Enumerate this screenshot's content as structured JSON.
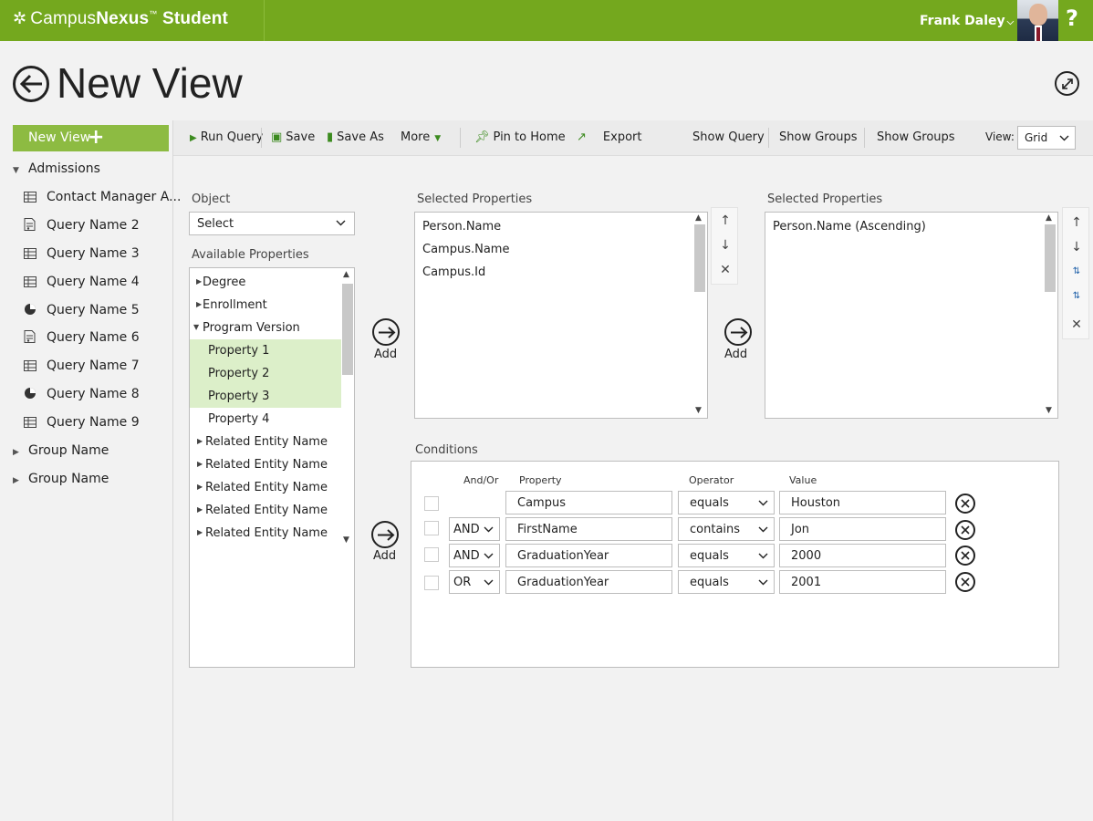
{
  "app": {
    "logo_prefix": "Campus",
    "logo_bold": "Nexus",
    "logo_tm": "™",
    "logo_suffix": " Student",
    "user_name": "Frank Daley",
    "help_label": "?"
  },
  "page": {
    "title": "New View"
  },
  "sidebar": {
    "new_view_label": "New View",
    "groups": [
      {
        "label": "Admissions",
        "expanded": true
      },
      {
        "label": "Group Name",
        "expanded": false
      },
      {
        "label": "Group Name",
        "expanded": false
      }
    ],
    "items": [
      {
        "label": "Contact Manager A...",
        "icon": "grid-icon"
      },
      {
        "label": "Query Name 2",
        "icon": "document-icon"
      },
      {
        "label": "Query Name 3",
        "icon": "grid-icon"
      },
      {
        "label": "Query Name 4",
        "icon": "grid-icon"
      },
      {
        "label": "Query Name 5",
        "icon": "pie-chart-icon"
      },
      {
        "label": "Query Name 6",
        "icon": "document-icon"
      },
      {
        "label": "Query Name 7",
        "icon": "grid-icon"
      },
      {
        "label": "Query Name 8",
        "icon": "pie-chart-icon"
      },
      {
        "label": "Query Name 9",
        "icon": "grid-icon"
      }
    ]
  },
  "toolbar": {
    "run_query": "Run Query",
    "save": "Save",
    "save_as": "Save As",
    "more": "More",
    "pin_to_home": "Pin to Home",
    "export": "Export",
    "show_query": "Show Query",
    "show_groups_1": "Show Groups",
    "show_groups_2": "Show Groups",
    "view_label": "View:",
    "view_value": "Grid"
  },
  "object": {
    "label": "Object",
    "value": "Select"
  },
  "available": {
    "label": "Available Properties",
    "rows": [
      {
        "label": "Degree",
        "type": "collapsed",
        "highlight": false
      },
      {
        "label": "Enrollment",
        "type": "collapsed",
        "highlight": false
      },
      {
        "label": "Program Version",
        "type": "expanded",
        "highlight": false
      },
      {
        "label": "Property 1",
        "type": "child",
        "highlight": true
      },
      {
        "label": "Property 2",
        "type": "child",
        "highlight": true
      },
      {
        "label": "Property 3",
        "type": "child",
        "highlight": true
      },
      {
        "label": "Property 4",
        "type": "child",
        "highlight": false
      },
      {
        "label": "Related Entity Name",
        "type": "collapsed",
        "highlight": false
      },
      {
        "label": "Related Entity Name",
        "type": "collapsed",
        "highlight": false
      },
      {
        "label": "Related Entity Name",
        "type": "collapsed",
        "highlight": false
      },
      {
        "label": "Related Entity Name",
        "type": "collapsed",
        "highlight": false
      },
      {
        "label": "Related Entity Name",
        "type": "collapsed",
        "highlight": false
      }
    ]
  },
  "add_label": "Add",
  "selected_properties": {
    "label": "Selected Properties",
    "items": [
      "Person.Name",
      "Campus.Name",
      "Campus.Id"
    ]
  },
  "sort_properties": {
    "label": "Selected Properties",
    "items": [
      "Person.Name (Ascending)"
    ]
  },
  "conditions": {
    "label": "Conditions",
    "headers": {
      "andor": "And/Or",
      "property": "Property",
      "operator": "Operator",
      "value": "Value"
    },
    "rows": [
      {
        "andor": "",
        "property": "Campus",
        "operator": "equals",
        "value": "Houston"
      },
      {
        "andor": "AND",
        "property": "FirstName",
        "operator": "contains",
        "value": "Jon"
      },
      {
        "andor": "AND",
        "property": "GraduationYear",
        "operator": "equals",
        "value": "2000"
      },
      {
        "andor": "OR",
        "property": "GraduationYear",
        "operator": "equals",
        "value": "2001"
      }
    ]
  },
  "colors": {
    "brand": "#74a81e",
    "button": "#8dbb42",
    "highlight": "#dcefc9"
  }
}
